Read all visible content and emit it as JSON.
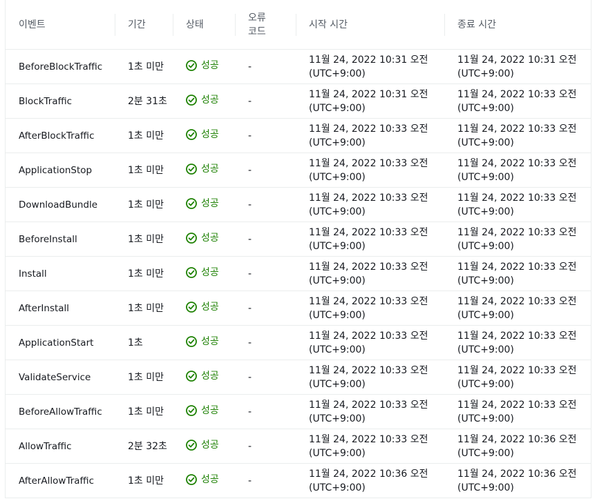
{
  "columns": {
    "event": "이벤트",
    "duration": "기간",
    "status": "상태",
    "error_code": "오류 코드",
    "start_time": "시작 시간",
    "end_time": "종료 시간"
  },
  "rows": [
    {
      "event": "BeforeBlockTraffic",
      "duration": "1초 미만",
      "status": "성공",
      "error": "-",
      "start": "11월 24, 2022 10:31 오전 (UTC+9:00)",
      "end": "11월 24, 2022 10:31 오전 (UTC+9:00)"
    },
    {
      "event": "BlockTraffic",
      "duration": "2분 31초",
      "status": "성공",
      "error": "-",
      "start": "11월 24, 2022 10:31 오전 (UTC+9:00)",
      "end": "11월 24, 2022 10:33 오전 (UTC+9:00)"
    },
    {
      "event": "AfterBlockTraffic",
      "duration": "1초 미만",
      "status": "성공",
      "error": "-",
      "start": "11월 24, 2022 10:33 오전 (UTC+9:00)",
      "end": "11월 24, 2022 10:33 오전 (UTC+9:00)"
    },
    {
      "event": "ApplicationStop",
      "duration": "1초 미만",
      "status": "성공",
      "error": "-",
      "start": "11월 24, 2022 10:33 오전 (UTC+9:00)",
      "end": "11월 24, 2022 10:33 오전 (UTC+9:00)"
    },
    {
      "event": "DownloadBundle",
      "duration": "1초 미만",
      "status": "성공",
      "error": "-",
      "start": "11월 24, 2022 10:33 오전 (UTC+9:00)",
      "end": "11월 24, 2022 10:33 오전 (UTC+9:00)"
    },
    {
      "event": "BeforeInstall",
      "duration": "1초 미만",
      "status": "성공",
      "error": "-",
      "start": "11월 24, 2022 10:33 오전 (UTC+9:00)",
      "end": "11월 24, 2022 10:33 오전 (UTC+9:00)"
    },
    {
      "event": "Install",
      "duration": "1초 미만",
      "status": "성공",
      "error": "-",
      "start": "11월 24, 2022 10:33 오전 (UTC+9:00)",
      "end": "11월 24, 2022 10:33 오전 (UTC+9:00)"
    },
    {
      "event": "AfterInstall",
      "duration": "1초 미만",
      "status": "성공",
      "error": "-",
      "start": "11월 24, 2022 10:33 오전 (UTC+9:00)",
      "end": "11월 24, 2022 10:33 오전 (UTC+9:00)"
    },
    {
      "event": "ApplicationStart",
      "duration": "1초",
      "status": "성공",
      "error": "-",
      "start": "11월 24, 2022 10:33 오전 (UTC+9:00)",
      "end": "11월 24, 2022 10:33 오전 (UTC+9:00)"
    },
    {
      "event": "ValidateService",
      "duration": "1초 미만",
      "status": "성공",
      "error": "-",
      "start": "11월 24, 2022 10:33 오전 (UTC+9:00)",
      "end": "11월 24, 2022 10:33 오전 (UTC+9:00)"
    },
    {
      "event": "BeforeAllowTraffic",
      "duration": "1초 미만",
      "status": "성공",
      "error": "-",
      "start": "11월 24, 2022 10:33 오전 (UTC+9:00)",
      "end": "11월 24, 2022 10:33 오전 (UTC+9:00)"
    },
    {
      "event": "AllowTraffic",
      "duration": "2분 32초",
      "status": "성공",
      "error": "-",
      "start": "11월 24, 2022 10:33 오전 (UTC+9:00)",
      "end": "11월 24, 2022 10:36 오전 (UTC+9:00)"
    },
    {
      "event": "AfterAllowTraffic",
      "duration": "1초 미만",
      "status": "성공",
      "error": "-",
      "start": "11월 24, 2022 10:36 오전 (UTC+9:00)",
      "end": "11월 24, 2022 10:36 오전 (UTC+9:00)"
    }
  ],
  "status_icon": "check-circle-icon",
  "colors": {
    "success": "#1d8102",
    "border": "#eaeded",
    "header_text": "#545b64"
  }
}
